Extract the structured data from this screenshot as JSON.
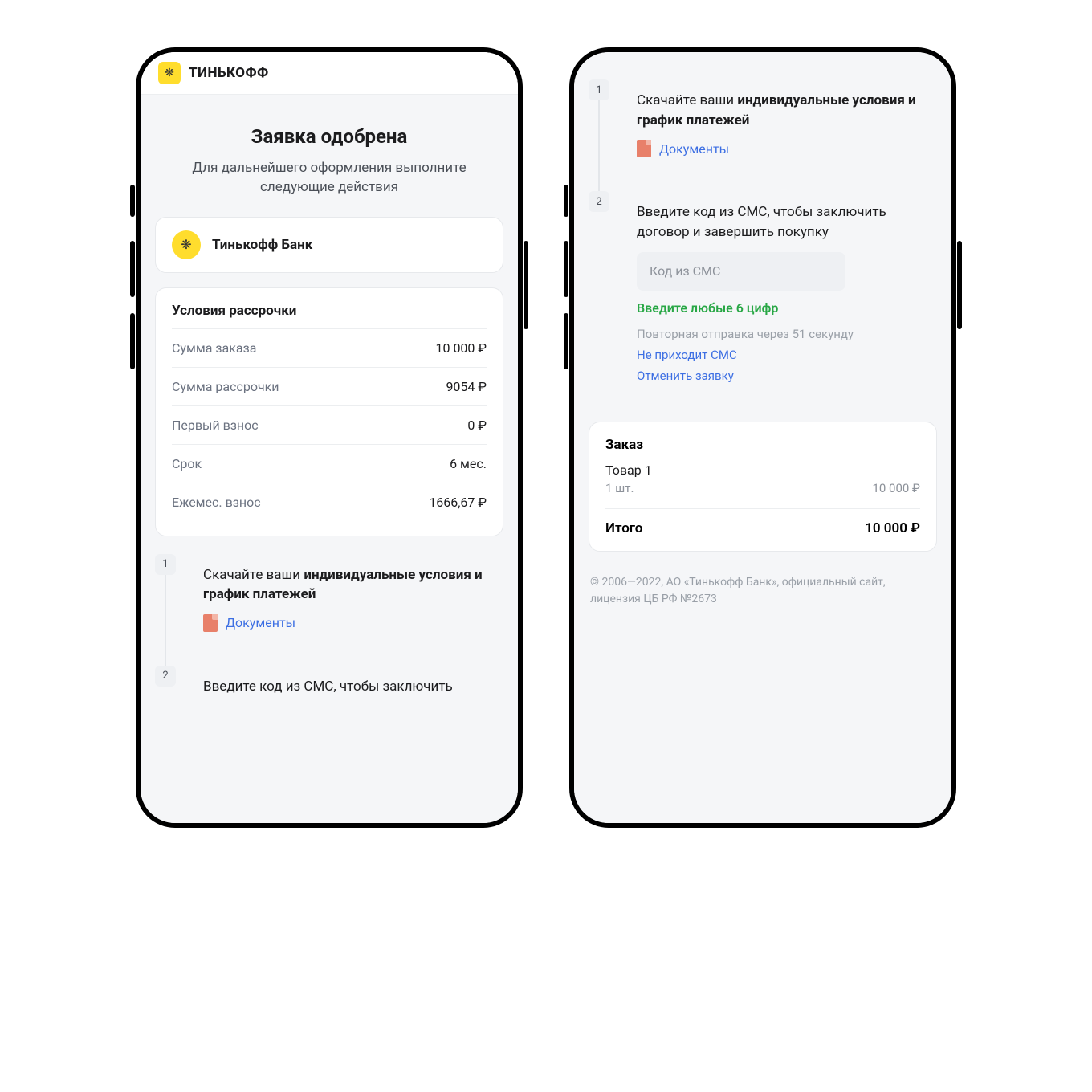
{
  "brand": {
    "name": "ТИНЬКОФФ",
    "logo_glyph": "❋"
  },
  "page": {
    "title": "Заявка одобрена",
    "subtitle": "Для дальнейшего оформления выполните следующие действия"
  },
  "bank": {
    "name": "Тинькофф Банк",
    "logo_glyph": "❋"
  },
  "terms": {
    "title": "Условия рассрочки",
    "rows": [
      {
        "label": "Сумма заказа",
        "value": "10 000 ₽"
      },
      {
        "label": "Сумма рассрочки",
        "value": "9054 ₽"
      },
      {
        "label": "Первый взнос",
        "value": "0 ₽"
      },
      {
        "label": "Срок",
        "value": "6 мес."
      },
      {
        "label": "Ежемес. взнос",
        "value": "1666,67 ₽"
      }
    ]
  },
  "steps": {
    "s1": {
      "num": "1",
      "text_prefix": "Скачайте ваши ",
      "text_bold": "индивидуальные условия и график платежей",
      "doc_label": "Документы"
    },
    "s2": {
      "num": "2",
      "text": "Введите код из СМС, чтобы заключить договор и завершить покупку",
      "text_partial": "Введите код из СМС, чтобы заключить",
      "sms_placeholder": "Код из СМС",
      "hint_green": "Введите любые 6 цифр",
      "resend": "Повторная отправка через 51 секунду",
      "no_sms": "Не приходит СМС",
      "cancel": "Отменить заявку"
    }
  },
  "order": {
    "title": "Заказ",
    "item_name": "Товар 1",
    "item_qty": "1 шт.",
    "item_price": "10 000 ₽",
    "total_label": "Итого",
    "total_value": "10 000 ₽"
  },
  "footer": "© 2006—2022, АО «Тинькофф Банк», официальный сайт, лицензия ЦБ РФ №2673"
}
